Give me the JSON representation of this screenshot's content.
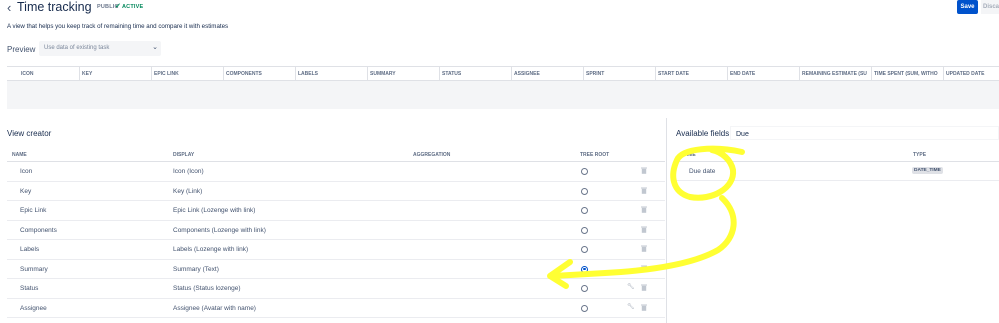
{
  "header": {
    "title": "Time tracking",
    "badge_public": "PUBLIC",
    "badge_active": "ACTIVE",
    "save_label": "Save",
    "discard_label": "Disca",
    "subtitle": "A view that helps you keep track of remaining time and compare it with estimates"
  },
  "preview": {
    "label": "Preview",
    "select_placeholder": "Use data of existing task"
  },
  "preview_columns": [
    "ICON",
    "KEY",
    "EPIC LINK",
    "COMPONENTS",
    "LABELS",
    "SUMMARY",
    "STATUS",
    "ASSIGNEE",
    "SPRINT",
    "START DATE",
    "END DATE",
    "REMAINING ESTIMATE (SU",
    "TIME SPENT (SUM, WITHO",
    "UPDATED DATE"
  ],
  "view_creator": {
    "title": "View creator",
    "headers": {
      "name": "NAME",
      "display": "DISPLAY",
      "aggregation": "AGGREGATION",
      "tree_root": "TREE ROOT"
    },
    "rows": [
      {
        "name": "Icon",
        "display": "Icon (Icon)",
        "tree_root": false,
        "editable": false
      },
      {
        "name": "Key",
        "display": "Key (Link)",
        "tree_root": false,
        "editable": false
      },
      {
        "name": "Epic Link",
        "display": "Epic Link (Lozenge with link)",
        "tree_root": false,
        "editable": false
      },
      {
        "name": "Components",
        "display": "Components (Lozenge with link)",
        "tree_root": false,
        "editable": false
      },
      {
        "name": "Labels",
        "display": "Labels (Lozenge with link)",
        "tree_root": false,
        "editable": false
      },
      {
        "name": "Summary",
        "display": "Summary (Text)",
        "tree_root": true,
        "editable": false
      },
      {
        "name": "Status",
        "display": "Status (Status lozenge)",
        "tree_root": false,
        "editable": true
      },
      {
        "name": "Assignee",
        "display": "Assignee (Avatar with name)",
        "tree_root": false,
        "editable": true
      }
    ]
  },
  "available_fields": {
    "title": "Available fields",
    "search_value": "Due",
    "headers": {
      "name": "NAME",
      "type": "TYPE"
    },
    "rows": [
      {
        "name": "Due date",
        "type": "DATE_TIME"
      }
    ]
  },
  "icons": {
    "back": "back-chevron-icon",
    "check": "check-icon",
    "dropdown": "chevron-down-icon",
    "delete": "trash-icon",
    "edit": "wrench-icon"
  },
  "colors": {
    "primary": "#0052cc",
    "active": "#00875a",
    "annotation": "#ffff33"
  }
}
